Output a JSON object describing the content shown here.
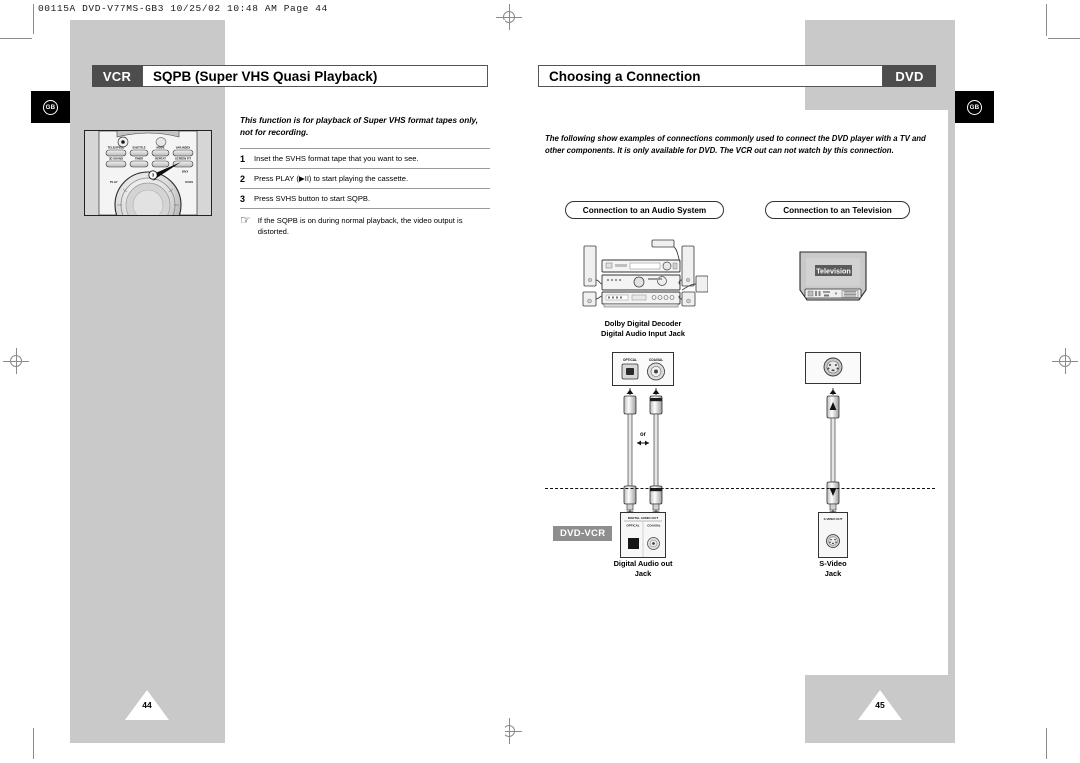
{
  "prepress": {
    "slug": "00115A  DVD-V77MS-GB3   10/25/02 10:48 AM   Page 44"
  },
  "left_page": {
    "badge": "GB",
    "page_number": "44",
    "header": {
      "chip": "VCR",
      "title": "SQPB (Super VHS Quasi Playback)"
    },
    "intro": "This function is for playback of Super VHS format tapes only, not for recording.",
    "steps": [
      {
        "num": "1",
        "text": "Inset the SVHS format tape that you want to see."
      },
      {
        "num": "2",
        "text": "Press PLAY (▶II) to start playing the cassette."
      },
      {
        "num": "3",
        "text": "Press SVHS button to start SQPB."
      }
    ],
    "note": {
      "icon": "pointing-hand-icon",
      "text": "If the SQPB is on during normal playback, the video output is distorted."
    },
    "remote": {
      "callout": "3",
      "row1": [
        "TELE/SPEED",
        "SUBTITLE",
        "MODE",
        "VAR.INDEX"
      ],
      "row2": [
        "3D SOUND",
        "TIMER",
        "REPEAT",
        "SCREEN FIT"
      ],
      "row2_sub": "DIVX"
    }
  },
  "right_page": {
    "badge": "GB",
    "page_number": "45",
    "header": {
      "title": "Choosing a Connection",
      "chip": "DVD"
    },
    "paragraph": "The following show examples of connections commonly used to connect the DVD player with a TV and other components. It is only available for DVD. The VCR out can not watch by this connection.",
    "sections": [
      {
        "label": "Connection to an Audio System"
      },
      {
        "label": "Connection to an Television"
      }
    ],
    "audio_branch": {
      "device_caption": "Dolby Digital Decoder\nDigital Audio Input Jack",
      "device_caption_line1": "Dolby Digital Decoder",
      "device_caption_line2": "Digital Audio Input Jack",
      "input_panel": {
        "optical": "OPTICAL",
        "coaxial": "COAXIAL"
      },
      "or_label": "or",
      "output_panel": {
        "title": "DIGITAL AUDIO OUT",
        "optical": "OPTICAL",
        "coaxial": "COAXIAL"
      },
      "jack_caption_line1": "Digital Audio out",
      "jack_caption_line2": "Jack"
    },
    "tv_branch": {
      "screen_label": "Television",
      "output_panel": {
        "title": "S-VIDEO OUT"
      },
      "jack_caption_line1": "S-Video",
      "jack_caption_line2": "Jack"
    },
    "device_tag": "DVD-VCR"
  },
  "colors": {
    "gray_panel": "#c9c9c9",
    "chip": "#4d4d4d",
    "tag": "#8e8e8e",
    "badge": "#000000"
  }
}
